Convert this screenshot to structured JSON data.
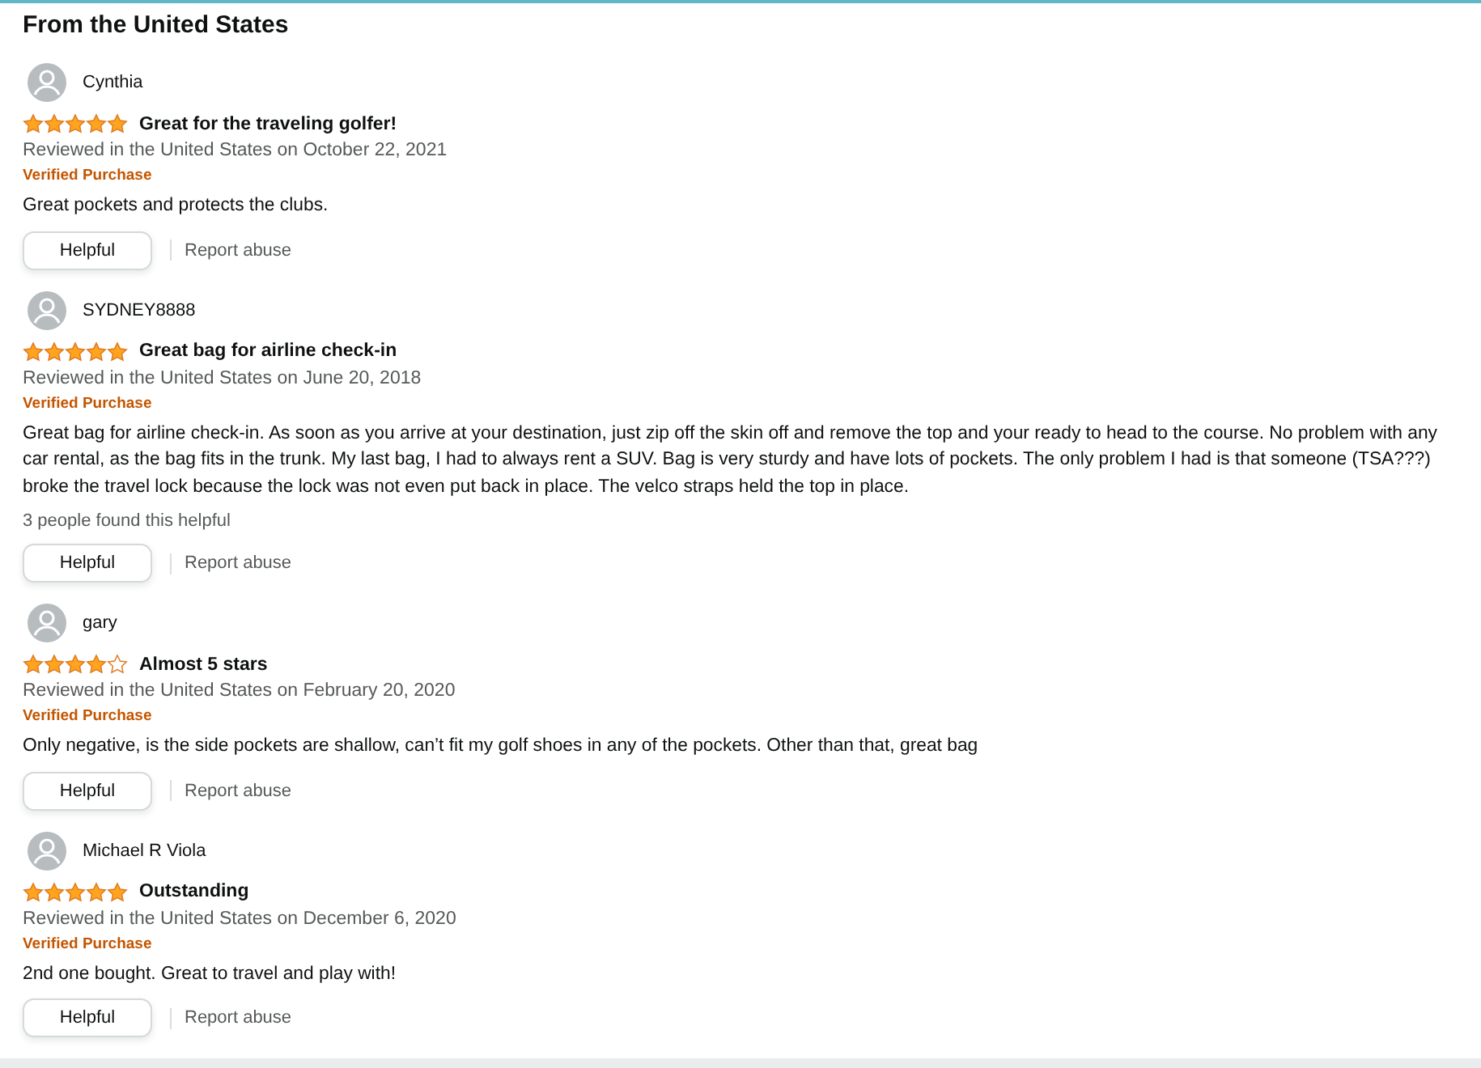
{
  "heading": "From the United States",
  "reviews": [
    {
      "name": "Cynthia",
      "stars": 5,
      "title": "Great for the traveling golfer!",
      "date": "Reviewed in the United States on October 22, 2021",
      "badge": "Verified Purchase",
      "body": "Great pockets and protects the clubs.",
      "helpful": "Helpful",
      "report": "Report abuse"
    },
    {
      "name": "SYDNEY8888",
      "stars": 5,
      "title": "Great bag for airline check-in",
      "date": "Reviewed in the United States on June 20, 2018",
      "badge": "Verified Purchase",
      "body": "Great bag for airline check-in. As soon as you arrive at your destination, just zip off the skin off and remove the top and your ready to head to the course. No problem with any car rental, as the bag fits in the trunk. My last bag, I had to always rent a SUV. Bag is very sturdy and have lots of pockets. The only problem I had is that someone (TSA???) broke the travel lock because the lock was not even put back in place. The velco straps held the top in place.",
      "helpful_count": "3 people found this helpful",
      "helpful": "Helpful",
      "report": "Report abuse"
    },
    {
      "name": "gary",
      "stars": 4,
      "title": "Almost 5 stars",
      "date": "Reviewed in the United States on February 20, 2020",
      "badge": "Verified Purchase",
      "body": "Only negative, is the side pockets are shallow, can’t fit my golf shoes in any of the pockets. Other than that, great bag",
      "helpful": "Helpful",
      "report": "Report abuse"
    },
    {
      "name": "Michael R Viola",
      "stars": 5,
      "title": "Outstanding",
      "date": "Reviewed in the United States on December 6, 2020",
      "badge": "Verified Purchase",
      "body": "2nd one bought. Great to travel and play with!",
      "helpful": "Helpful",
      "report": "Report abuse"
    }
  ]
}
